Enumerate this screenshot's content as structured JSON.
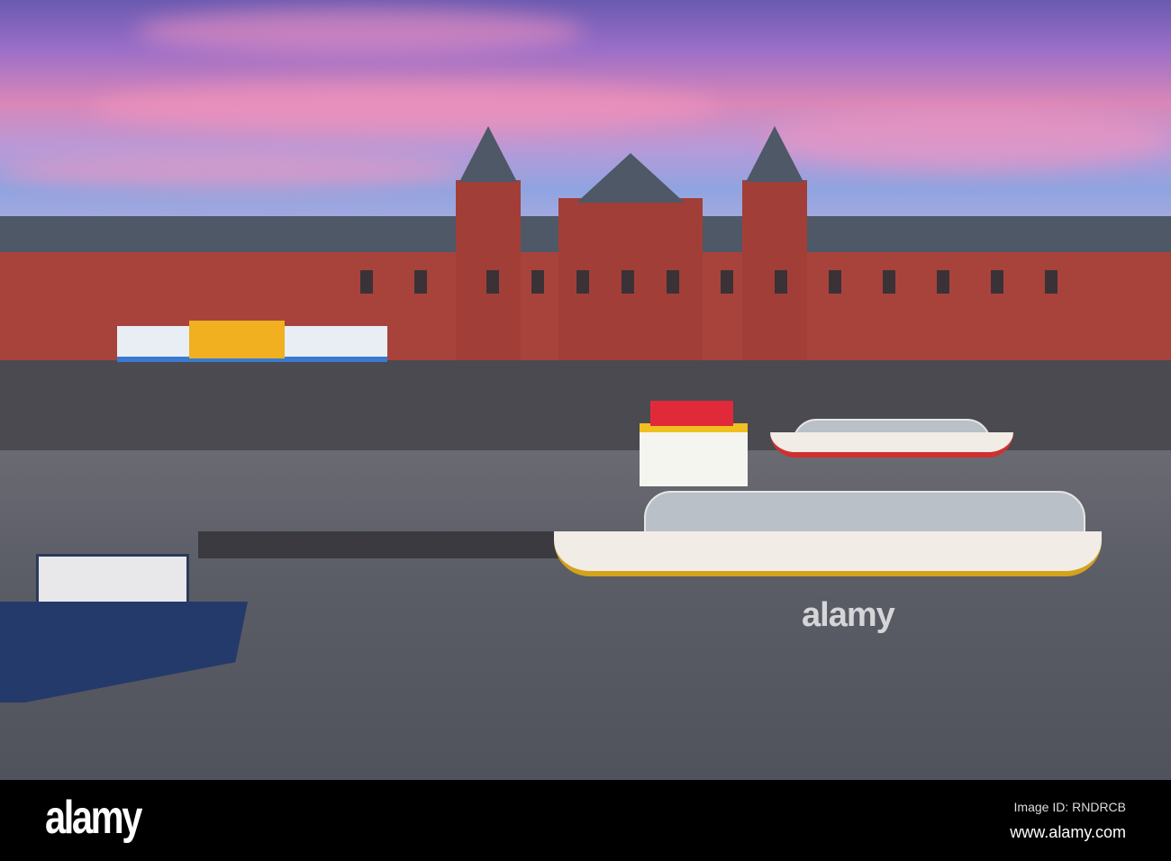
{
  "watermark": {
    "logo": "alamy",
    "center_text": "alamy"
  },
  "footer": {
    "logo": "alamy",
    "image_id": "Image ID: RNDRCB",
    "url": "www.alamy.com"
  },
  "colors": {
    "brick": "#a8433c",
    "roof": "#4e5866",
    "water": "#5a5c66",
    "accent_yellow": "#f0b020"
  }
}
